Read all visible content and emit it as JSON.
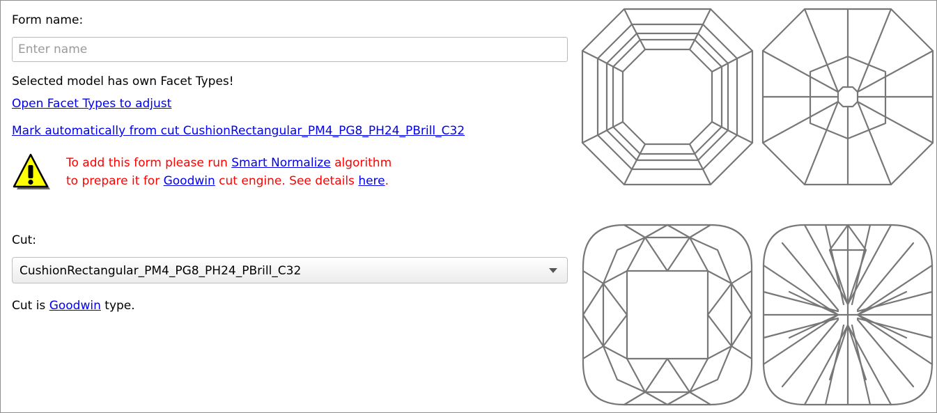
{
  "form_name": {
    "label": "Form name:",
    "placeholder": "Enter name",
    "value": ""
  },
  "facet_types": {
    "notice": "Selected model has own Facet Types!",
    "open_link": "Open Facet Types to adjust",
    "mark_link": "Mark automatically from cut CushionRectangular_PM4_PG8_PH24_PBrill_C32"
  },
  "warning": {
    "line1_pre": "To add this form please run ",
    "line1_link": "Smart Normalize",
    "line1_post": " algorithm",
    "line2_pre": "to prepare it for ",
    "line2_link": "Goodwin",
    "line2_mid": " cut engine. See details ",
    "line2_link2": "here",
    "line2_post": "."
  },
  "cut": {
    "label": "Cut:",
    "selected": "CushionRectangular_PM4_PG8_PH24_PBrill_C32",
    "type_pre": "Cut is ",
    "type_link": "Goodwin",
    "type_post": " type."
  },
  "colors": {
    "link": "#0000ee",
    "warning_text": "#ff0000",
    "facet_stroke": "#777777",
    "warning_icon_fill": "#ffff00"
  },
  "icons": {
    "warning": "warning-triangle-icon",
    "dropdown": "chevron-down-icon"
  },
  "previews": [
    {
      "name": "octagon-crown-view"
    },
    {
      "name": "octagon-pavilion-view"
    },
    {
      "name": "cushion-crown-view"
    },
    {
      "name": "cushion-pavilion-view"
    }
  ]
}
